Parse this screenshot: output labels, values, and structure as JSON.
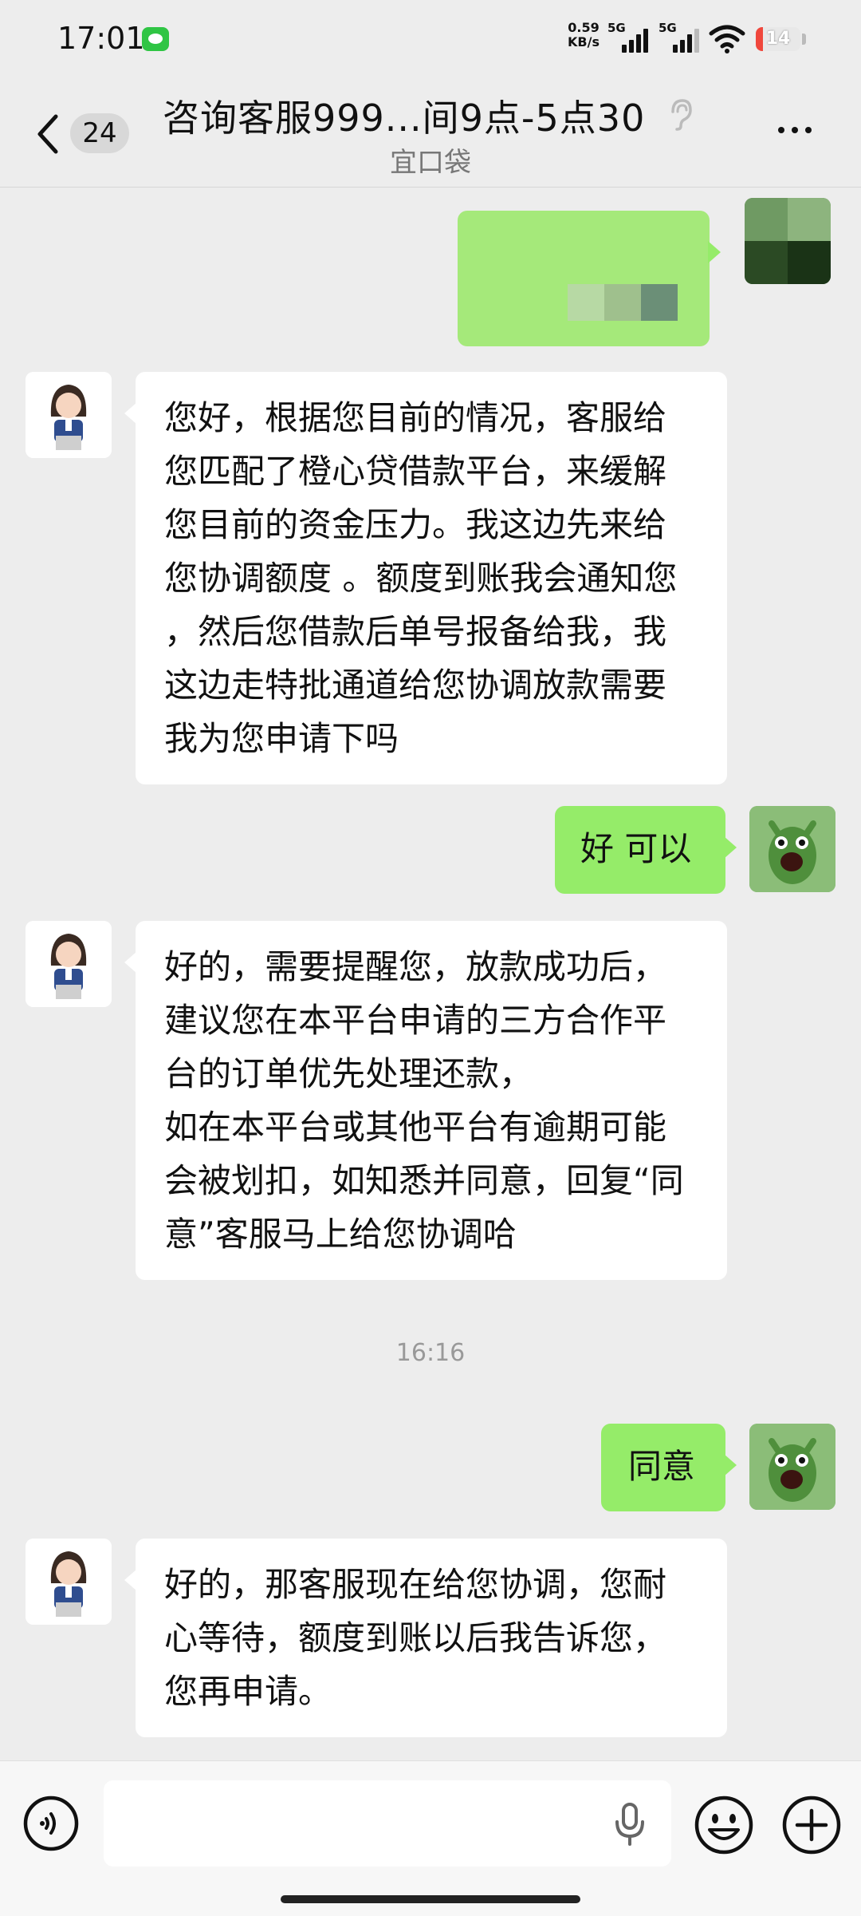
{
  "status_bar": {
    "time": "17:01",
    "net_speed_value": "0.59",
    "net_speed_unit": "KB/s",
    "sim1_label": "5G",
    "sim2_label": "5G",
    "battery": "14",
    "battery_color": "#f0473c"
  },
  "header": {
    "unread_count": "24",
    "title": "咨询客服999...间9点-5点30",
    "subtitle": "宜口袋"
  },
  "messages": [
    {
      "side": "out",
      "text": "",
      "redacted": true
    },
    {
      "side": "in",
      "text": "您好，根据您目前的情况，客服给您匹配了橙心贷借款平台，来缓解您目前的资金压力。我这边先来给您协调额度 。额度到账我会通知您 ，然后您借款后单号报备给我，我这边走特批通道给您协调放款需要我为您申请下吗"
    },
    {
      "side": "out",
      "text": "好 可以"
    },
    {
      "side": "in",
      "text": "好的，需要提醒您，放款成功后，建议您在本平台申请的三方合作平台的订单优先处理还款，\n如在本平台或其他平台有逾期可能会被划扣，如知悉并同意，回复“同意”客服马上给您协调哈"
    },
    {
      "side": "out",
      "text": "同意"
    },
    {
      "side": "in",
      "text": "好的，那客服现在给您协调，您耐心等待，额度到账以后我告诉您，您再申请。"
    }
  ],
  "timestamp": "16:16",
  "colors": {
    "out_bubble": "#95ec69",
    "in_bubble": "#ffffff",
    "background": "#ededed"
  }
}
